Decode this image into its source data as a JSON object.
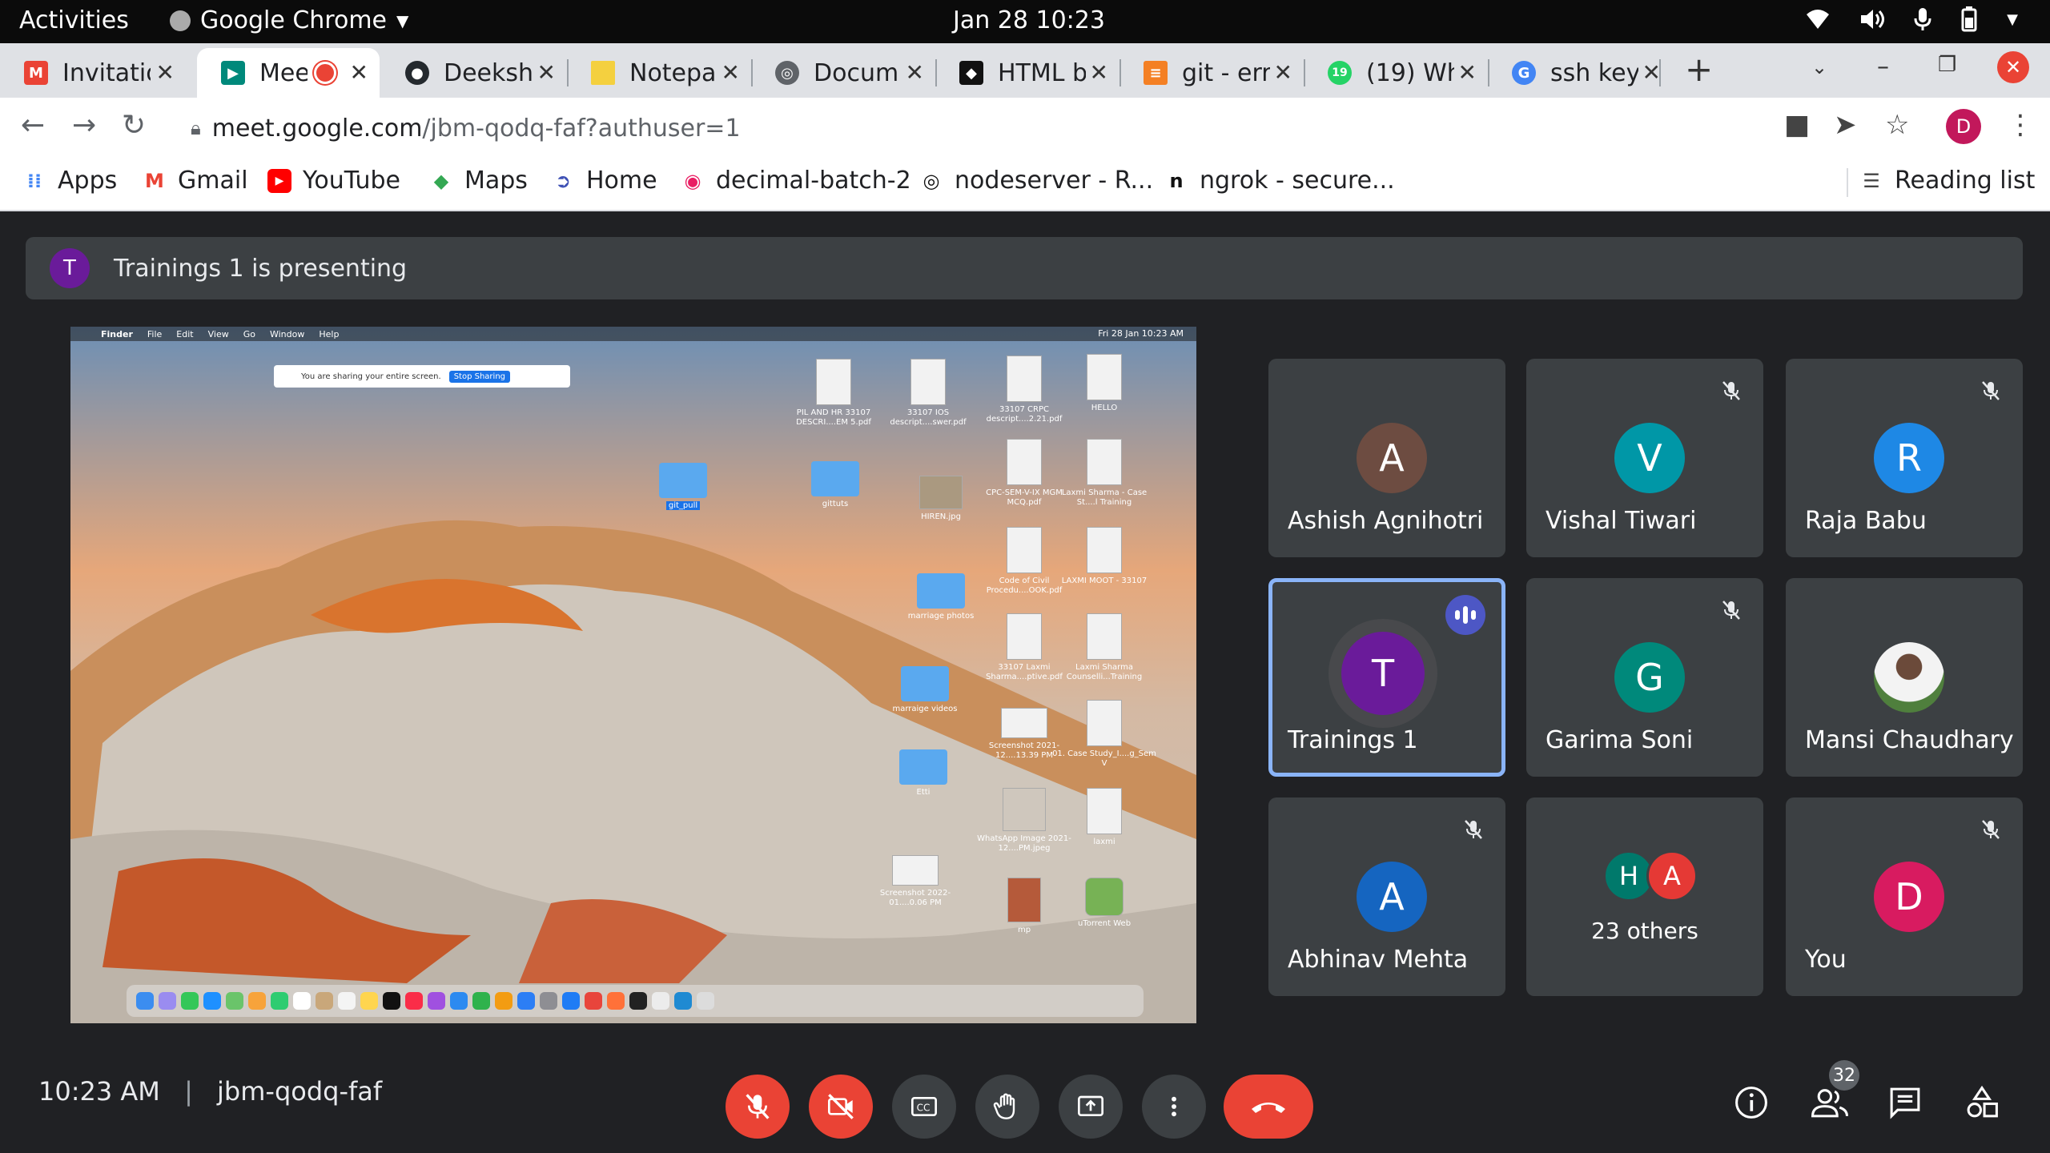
{
  "os": {
    "activities": "Activities",
    "app_name": "Google Chrome",
    "clock": "Jan 28  10:23"
  },
  "tabs": [
    {
      "title": "Invitatio",
      "color": "#ea4335",
      "icon": "gmail-icon"
    },
    {
      "title": "Mee",
      "color": "#00897b",
      "icon": "meet-icon",
      "active": true
    },
    {
      "title": "Deeksh",
      "color": "#24292e",
      "icon": "github-icon"
    },
    {
      "title": "Notepa",
      "color": "#f4d03f",
      "icon": "notepad-icon"
    },
    {
      "title": "Docum",
      "color": "#5f6368",
      "icon": "globe-icon"
    },
    {
      "title": "HTML b",
      "color": "#111111",
      "icon": "html-icon"
    },
    {
      "title": "git - err",
      "color": "#f48024",
      "icon": "stackoverflow-icon"
    },
    {
      "title": "(19) Wh",
      "color": "#25d366",
      "icon": "whatsapp-icon"
    },
    {
      "title": "ssh key",
      "color": "#4285f4",
      "icon": "google-icon"
    }
  ],
  "address": {
    "host": "meet.google.com",
    "path": "/jbm-qodq-faf?authuser=1",
    "profile_initial": "D"
  },
  "bookmarks": [
    {
      "label": "Apps",
      "icon": "apps-grid-icon"
    },
    {
      "label": "Gmail",
      "icon": "gmail-icon"
    },
    {
      "label": "YouTube",
      "icon": "youtube-icon"
    },
    {
      "label": "Maps",
      "icon": "maps-icon"
    },
    {
      "label": "Home",
      "icon": "home-icon"
    },
    {
      "label": "decimal-batch-2",
      "icon": "replit-icon"
    },
    {
      "label": "nodeserver - R...",
      "icon": "replit-icon"
    },
    {
      "label": "ngrok - secure...",
      "icon": "ngrok-icon"
    }
  ],
  "reading_list": "Reading list",
  "meet": {
    "presenter_initial": "T",
    "presenting_text": "Trainings 1 is presenting",
    "shared_screen": {
      "menubar": [
        "Finder",
        "File",
        "Edit",
        "View",
        "Go",
        "Window",
        "Help"
      ],
      "menubar_right": "Fri 28 Jan  10:23 AM",
      "sharing_text": "You are sharing your entire screen.",
      "stop_sharing": "Stop Sharing",
      "desktop_items": [
        "PIL AND HR 33107 DESCRI....EM 5.pdf",
        "33107 IOS descript....swer.pdf",
        "33107 CRPC descript....2.21.pdf",
        "HELLO",
        "git_pull",
        "gittuts",
        "HIREN.jpg",
        "CPC-SEM-V-IX MGM MCQ.pdf",
        "Laxmi Sharma - Case St....l Training",
        "Code of Civil Procedu....OOK.pdf",
        "LAXMI MOOT - 33107",
        "marriage photos",
        "33107 Laxmi Sharma....ptive.pdf",
        "Laxmi Sharma Counselli...Training",
        "marraige videos",
        "Screenshot 2021-12....13.39 PM",
        "01. Case Study_I....g_Sem V",
        "Etti",
        "WhatsApp Image 2021-12....PM.jpeg",
        "laxmi",
        "Screenshot 2022-01....0.06 PM",
        "mp",
        "uTorrent Web"
      ]
    },
    "participants": [
      {
        "initial": "A",
        "name": "Ashish Agnihotri",
        "color": "#6d4c41",
        "muted": false
      },
      {
        "initial": "V",
        "name": "Vishal Tiwari",
        "color": "#0097a7",
        "muted": true
      },
      {
        "initial": "R",
        "name": "Raja Babu",
        "color": "#1e88e5",
        "muted": true
      },
      {
        "initial": "T",
        "name": "Trainings 1",
        "color": "#6a1b9a",
        "speaking": true
      },
      {
        "initial": "G",
        "name": "Garima Soni",
        "color": "#00897b",
        "muted": true
      },
      {
        "initial": "",
        "name": "Mansi Chaudhary",
        "photo": true,
        "muted": false
      },
      {
        "initial": "A",
        "name": "Abhinav Mehta",
        "color": "#1565c0",
        "muted": true
      },
      {
        "initials": [
          "H",
          "A"
        ],
        "name": "23 others",
        "colors": [
          "#00796b",
          "#e53935"
        ]
      },
      {
        "initial": "D",
        "name": "You",
        "color": "#d81b60",
        "muted": true
      }
    ],
    "time": "10:23 AM",
    "separator": "|",
    "meeting_code": "jbm-qodq-faf",
    "participant_count": "32"
  }
}
